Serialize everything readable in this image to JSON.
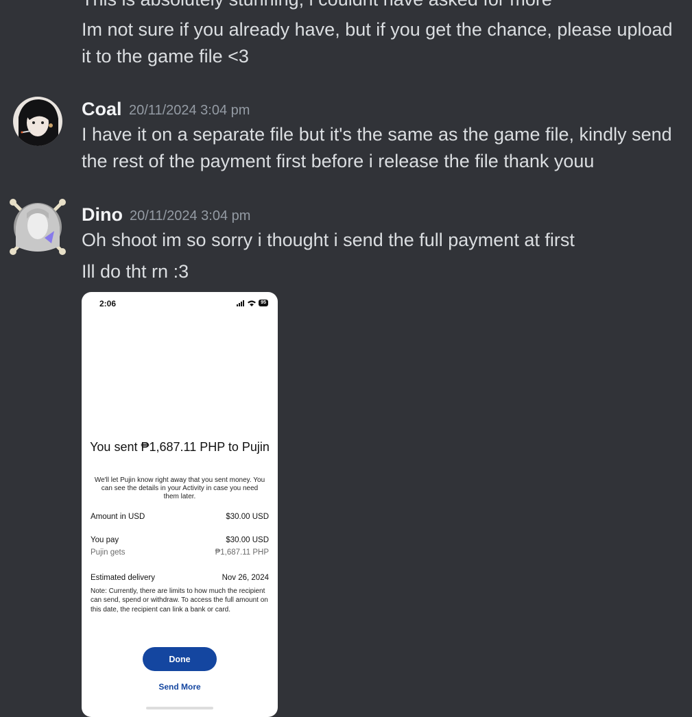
{
  "messages": {
    "prev": {
      "line_cut": "This is absolutely stunning, i couldnt have asked for more",
      "line1": "Im not sure if you already have, but if you get the chance, please upload",
      "line2": "it to the game file <3"
    },
    "coal": {
      "author": "Coal",
      "timestamp": "20/11/2024 3:04 pm",
      "line1": "I have it on a separate file but it's the same as the game file, kindly send",
      "line2": "the rest of the payment first before i release the file thank youu"
    },
    "dino": {
      "author": "Dino",
      "timestamp": "20/11/2024 3:04 pm",
      "line1": "Oh shoot im so sorry i thought i send the full payment at first",
      "line2": "Ill do tht rn :3"
    }
  },
  "attachment": {
    "status_time": "2:06",
    "battery": "95",
    "title": "You sent ₱1,687.11 PHP to Pujin",
    "description": "We'll let Pujin know right away that you sent money. You can see the details in your Activity in case you need them later.",
    "rows": [
      {
        "label": "Amount in USD",
        "value": "$30.00 USD"
      },
      {
        "label": "You pay",
        "value": "$30.00 USD"
      },
      {
        "label": "Pujin gets",
        "value": "₱1,687.11 PHP"
      },
      {
        "label": "Estimated delivery",
        "value": "Nov 26, 2024"
      }
    ],
    "note": "Note: Currently, there are limits to how much the recipient can send, spend or withdraw. To access the full amount on this date, the recipient can link a bank or card.",
    "done_label": "Done",
    "send_more_label": "Send More"
  },
  "colors": {
    "background": "#313338",
    "text": "#dbdee1",
    "timestamp": "#949ba4",
    "paypal_blue": "#1446a0"
  }
}
